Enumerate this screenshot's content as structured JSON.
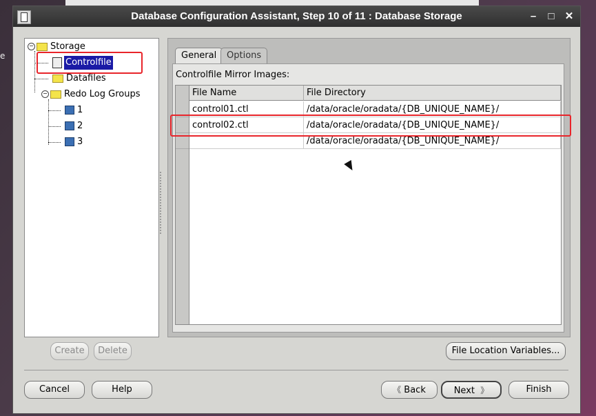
{
  "window": {
    "title": "Database Configuration Assistant, Step 10 of 11 : Database Storage"
  },
  "tree": {
    "root": "Storage",
    "items": [
      {
        "label": "Controlfile",
        "selected": true
      },
      {
        "label": "Datafiles"
      },
      {
        "label": "Redo Log Groups"
      },
      {
        "label": "1"
      },
      {
        "label": "2"
      },
      {
        "label": "3"
      }
    ]
  },
  "tabs": {
    "general": "General",
    "options": "Options"
  },
  "section": {
    "label": "Controlfile Mirror Images:"
  },
  "table": {
    "headers": [
      "File Name",
      "File Directory"
    ],
    "rows": [
      {
        "name": "control01.ctl",
        "dir": "/data/oracle/oradata/{DB_UNIQUE_NAME}/"
      },
      {
        "name": "control02.ctl",
        "dir": "/data/oracle/oradata/{DB_UNIQUE_NAME}/"
      },
      {
        "name": "",
        "dir": "/data/oracle/oradata/{DB_UNIQUE_NAME}/"
      }
    ]
  },
  "buttons": {
    "create": "Create",
    "delete": "Delete",
    "file_location": "File Location Variables...",
    "cancel": "Cancel",
    "help": "Help",
    "back": "Back",
    "next": "Next",
    "finish": "Finish"
  },
  "desktop": {
    "left_text": "e"
  },
  "colors": {
    "highlight": "#e8242a",
    "selection": "#1a1aa6"
  }
}
